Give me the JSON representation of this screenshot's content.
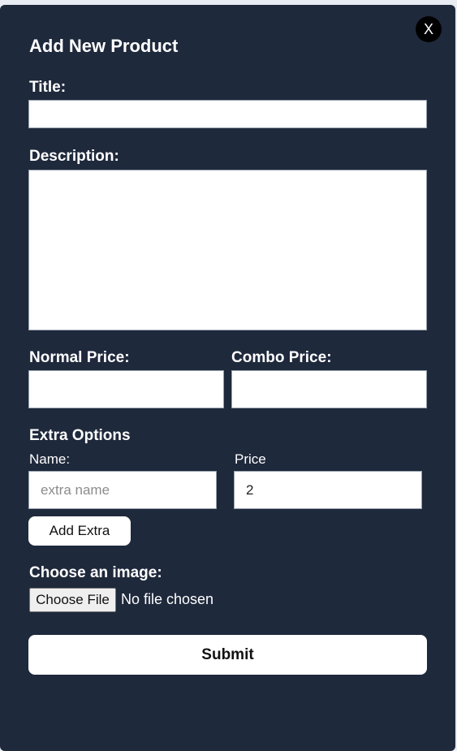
{
  "modal": {
    "close_label": "X",
    "title": "Add New Product"
  },
  "form": {
    "title_label": "Title:",
    "title_value": "",
    "description_label": "Description:",
    "description_value": "",
    "normal_price_label": "Normal Price:",
    "normal_price_value": "",
    "combo_price_label": "Combo Price:",
    "combo_price_value": ""
  },
  "extras": {
    "heading": "Extra Options",
    "name_label": "Name:",
    "name_placeholder": "extra name",
    "name_value": "",
    "price_label": "Price",
    "price_value": "2",
    "add_button_label": "Add Extra"
  },
  "image": {
    "label": "Choose an image:",
    "choose_button_label": "Choose File",
    "status_text": "No file chosen"
  },
  "submit_label": "Submit",
  "colors": {
    "modal_bg": "#1f293c",
    "text": "#ffffff",
    "field_bg": "#ffffff"
  }
}
